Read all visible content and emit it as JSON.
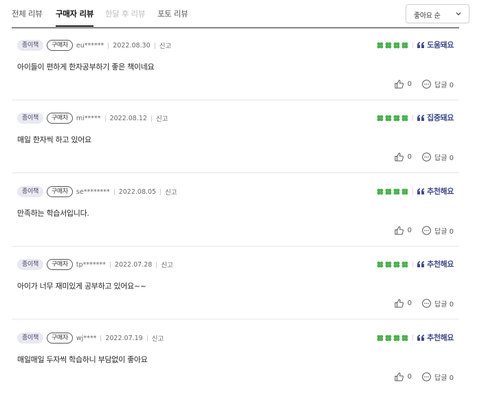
{
  "tabs": [
    {
      "label": "전체 리뷰",
      "state": "normal"
    },
    {
      "label": "구매자 리뷰",
      "state": "active"
    },
    {
      "label": "한달 후 리뷰",
      "state": "disabled"
    },
    {
      "label": "포토 리뷰",
      "state": "normal"
    }
  ],
  "sort": {
    "selected": "좋아요 순"
  },
  "colors": {
    "accent": "#3d4a8a",
    "clover": "#4caf50"
  },
  "reviews": [
    {
      "format": "종이책",
      "badge": "구매자",
      "user": "eu******",
      "date": "2022.08.30",
      "report": "신고",
      "tag": "도움돼요",
      "text": "아이들이 편하게 한자공부하기 좋은 책이네요",
      "likes": "0",
      "reply": "답글 0",
      "rating": 4
    },
    {
      "format": "종이책",
      "badge": "구매자",
      "user": "mi*****",
      "date": "2022.08.12",
      "report": "신고",
      "tag": "집중돼요",
      "text": "매일 한자씩 하고 있어요",
      "likes": "0",
      "reply": "답글 0",
      "rating": 4
    },
    {
      "format": "종이책",
      "badge": "구매자",
      "user": "se********",
      "date": "2022.08.05",
      "report": "신고",
      "tag": "추천해요",
      "text": "만족하는 학습서입니다.",
      "likes": "0",
      "reply": "답글 0",
      "rating": 4
    },
    {
      "format": "종이책",
      "badge": "구매자",
      "user": "tp*******",
      "date": "2022.07.28",
      "report": "신고",
      "tag": "추천해요",
      "text": "아이가 너무 재미있게 공부하고 있어요~~",
      "likes": "0",
      "reply": "답글 0",
      "rating": 4
    },
    {
      "format": "종이책",
      "badge": "구매자",
      "user": "wj****",
      "date": "2022.07.19",
      "report": "신고",
      "tag": "추천해요",
      "text": "매일매일 두자씩 학습하니 부담없이 좋아요",
      "likes": "0",
      "reply": "답글 0",
      "rating": 4
    }
  ]
}
